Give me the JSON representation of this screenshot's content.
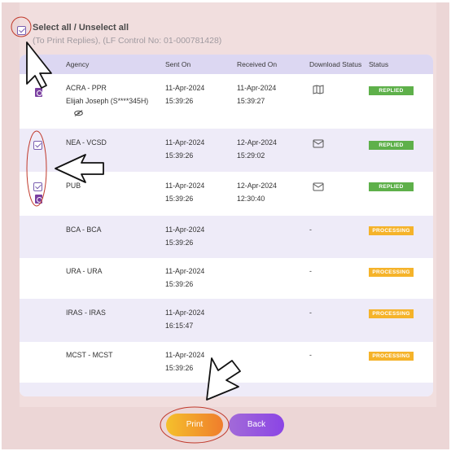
{
  "header": {
    "select_all_label": "Select all / Unselect all",
    "hint": "(To Print Replies), (LF Control No: 01-000781428)"
  },
  "table": {
    "columns": [
      "Agency",
      "Sent On",
      "Received On",
      "Download Status",
      "Status"
    ],
    "rows": [
      {
        "agency": "ACRA - PPR",
        "agency_sub": "Elijah Joseph (S****345H)",
        "sent_date": "11-Apr-2024",
        "sent_time": "15:39:26",
        "recv_date": "11-Apr-2024",
        "recv_time": "15:39:27",
        "download": "map-icon",
        "status": "REPLIED",
        "checkbox": false
      },
      {
        "agency": "NEA - VCSD",
        "agency_sub": "",
        "sent_date": "11-Apr-2024",
        "sent_time": "15:39:26",
        "recv_date": "12-Apr-2024",
        "recv_time": "15:29:02",
        "download": "mail-icon",
        "status": "REPLIED",
        "checkbox": true
      },
      {
        "agency": "PUB",
        "agency_sub": "",
        "sent_date": "11-Apr-2024",
        "sent_time": "15:39:26",
        "recv_date": "12-Apr-2024",
        "recv_time": "12:30:40",
        "download": "mail-icon",
        "status": "REPLIED",
        "checkbox": true
      },
      {
        "agency": "BCA - BCA",
        "agency_sub": "",
        "sent_date": "11-Apr-2024",
        "sent_time": "15:39:26",
        "recv_date": "",
        "recv_time": "",
        "download": "-",
        "status": "PROCESSING",
        "checkbox": false
      },
      {
        "agency": "URA - URA",
        "agency_sub": "",
        "sent_date": "11-Apr-2024",
        "sent_time": "15:39:26",
        "recv_date": "",
        "recv_time": "",
        "download": "-",
        "status": "PROCESSING",
        "checkbox": false
      },
      {
        "agency": "IRAS - IRAS",
        "agency_sub": "",
        "sent_date": "11-Apr-2024",
        "sent_time": "16:15:47",
        "recv_date": "",
        "recv_time": "",
        "download": "-",
        "status": "PROCESSING",
        "checkbox": false
      },
      {
        "agency": "MCST - MCST",
        "agency_sub": "",
        "sent_date": "11-Apr-2024",
        "sent_time": "15:39:26",
        "recv_date": "",
        "recv_time": "",
        "download": "-",
        "status": "PROCESSING",
        "checkbox": false
      }
    ]
  },
  "buttons": {
    "print": "Print",
    "back": "Back"
  },
  "colors": {
    "replied": "#5eb04a",
    "processing": "#f5b32a",
    "header_bg": "#dcd7f2",
    "accent": "#7a5fb0"
  }
}
